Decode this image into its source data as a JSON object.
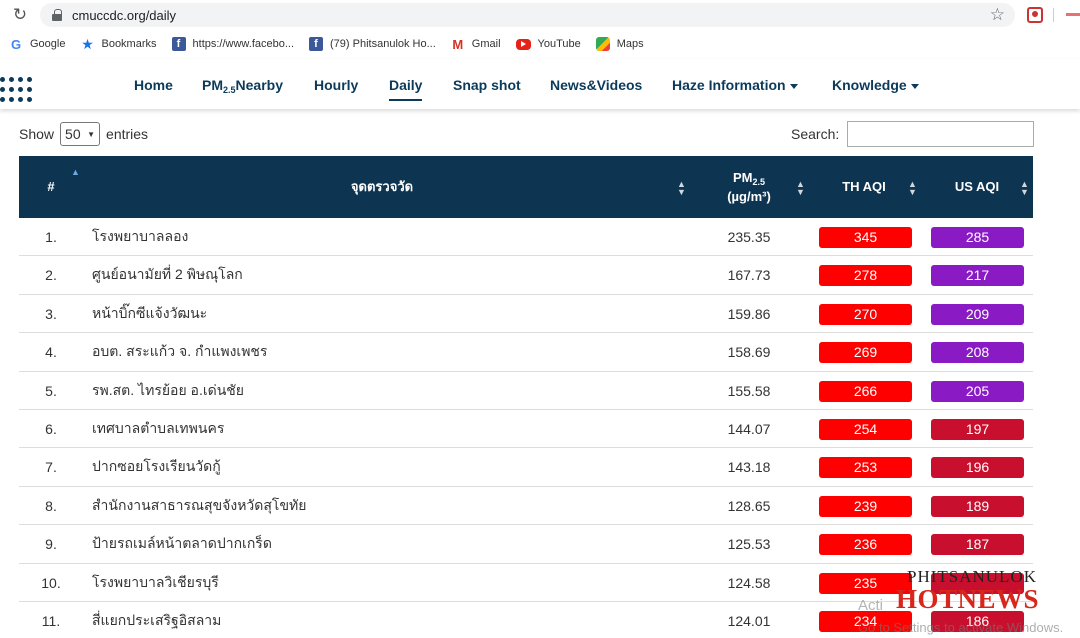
{
  "browser": {
    "url": "cmuccdc.org/daily",
    "bookmarks": [
      {
        "label": "Google",
        "icon": "google-icon"
      },
      {
        "label": "Bookmarks",
        "icon": "star-icon"
      },
      {
        "label": "https://www.facebo...",
        "icon": "facebook-icon"
      },
      {
        "label": "(79) Phitsanulok Ho...",
        "icon": "facebook-icon"
      },
      {
        "label": "Gmail",
        "icon": "gmail-icon"
      },
      {
        "label": "YouTube",
        "icon": "youtube-icon"
      },
      {
        "label": "Maps",
        "icon": "maps-icon"
      }
    ]
  },
  "nav": {
    "home": "Home",
    "pm_prefix": "PM",
    "pm_sub": "2.5",
    "pm_suffix": "Nearby",
    "hourly": "Hourly",
    "daily": "Daily",
    "snapshot": "Snap shot",
    "news": "News&Videos",
    "haze": "Haze Information",
    "knowledge": "Knowledge"
  },
  "controls": {
    "show": "Show",
    "entries_value": "50",
    "entries": "entries",
    "search": "Search:"
  },
  "table": {
    "headers": {
      "num": "#",
      "station": "จุดตรวจวัด",
      "pm_main": "PM",
      "pm_sub": "2.5",
      "pm_unit": "(µg/m³)",
      "th_aqi": "TH AQI",
      "us_aqi": "US AQI"
    },
    "rows": [
      {
        "num": "1.",
        "name": "โรงพยาบาลลอง",
        "pm": "235.35",
        "th": "345",
        "us": "285",
        "th_color": "#ff0000",
        "us_color": "#8a1bc4"
      },
      {
        "num": "2.",
        "name": "ศูนย์อนามัยที่ 2 พิษณุโลก",
        "pm": "167.73",
        "th": "278",
        "us": "217",
        "th_color": "#ff0000",
        "us_color": "#8a1bc4"
      },
      {
        "num": "3.",
        "name": "หน้าบิ๊กซีแจ้งวัฒนะ",
        "pm": "159.86",
        "th": "270",
        "us": "209",
        "th_color": "#ff0000",
        "us_color": "#8a1bc4"
      },
      {
        "num": "4.",
        "name": "อบต. สระแก้ว จ. กำแพงเพชร",
        "pm": "158.69",
        "th": "269",
        "us": "208",
        "th_color": "#ff0000",
        "us_color": "#8a1bc4"
      },
      {
        "num": "5.",
        "name": "รพ.สต. ไทรย้อย อ.เด่นชัย",
        "pm": "155.58",
        "th": "266",
        "us": "205",
        "th_color": "#ff0000",
        "us_color": "#8a1bc4"
      },
      {
        "num": "6.",
        "name": "เทศบาลตำบลเทพนคร",
        "pm": "144.07",
        "th": "254",
        "us": "197",
        "th_color": "#ff0000",
        "us_color": "#c8102e"
      },
      {
        "num": "7.",
        "name": "ปากซอยโรงเรียนวัดกู้",
        "pm": "143.18",
        "th": "253",
        "us": "196",
        "th_color": "#ff0000",
        "us_color": "#c8102e"
      },
      {
        "num": "8.",
        "name": "สำนักงานสาธารณสุขจังหวัดสุโขทัย",
        "pm": "128.65",
        "th": "239",
        "us": "189",
        "th_color": "#ff0000",
        "us_color": "#c8102e"
      },
      {
        "num": "9.",
        "name": "ป้ายรถเมล์หน้าตลาดปากเกร็ด",
        "pm": "125.53",
        "th": "236",
        "us": "187",
        "th_color": "#ff0000",
        "us_color": "#c8102e"
      },
      {
        "num": "10.",
        "name": "โรงพยาบาลวิเชียรบุรี",
        "pm": "124.58",
        "th": "235",
        "us": "",
        "th_color": "#ff0000",
        "us_color": "#c8102e"
      },
      {
        "num": "11.",
        "name": "สี่แยกประเสริฐอิสลาม",
        "pm": "124.01",
        "th": "234",
        "us": "186",
        "th_color": "#ff0000",
        "us_color": "#c8102e"
      }
    ]
  },
  "overlay": {
    "watermark_top": "PHITSANULOK",
    "watermark_bottom": "HOTNEWS",
    "activate_1": "Acti",
    "activate_2": "Go to Settings to activate Windows."
  }
}
